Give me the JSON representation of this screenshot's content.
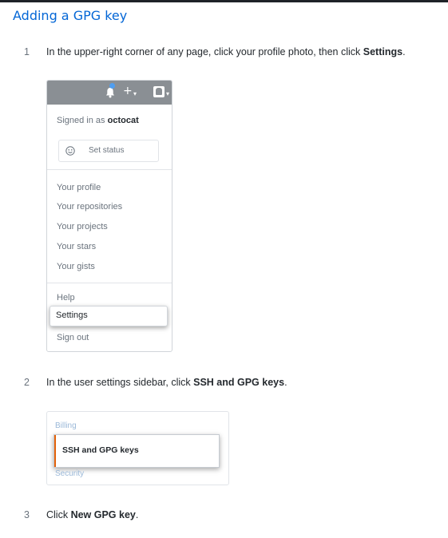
{
  "title": "Adding a GPG key",
  "steps": [
    {
      "num": "1",
      "before": "In the upper-right corner of any page, click your profile photo, then click ",
      "bold": "Settings",
      "after": "."
    },
    {
      "num": "2",
      "before": "In the user settings sidebar, click ",
      "bold": "SSH and GPG keys",
      "after": "."
    },
    {
      "num": "3",
      "before": "Click ",
      "bold": "New GPG key",
      "after": "."
    }
  ],
  "dropdown": {
    "plus": "+",
    "caret": "▾",
    "signed_prefix": "Signed in as ",
    "username": "octocat",
    "status_label": "Set status",
    "menu_items": [
      "Your profile",
      "Your repositories",
      "Your projects",
      "Your stars",
      "Your gists"
    ],
    "help": "Help",
    "settings": "Settings",
    "sign_out": "Sign out"
  },
  "sidebar": {
    "billing": "Billing",
    "ssh_gpg": "SSH and GPG keys",
    "security": "Security"
  },
  "colors": {
    "title": "#0366d6",
    "header_bar": "#8a8f94",
    "notification_dot": "#4f9ef0",
    "active_indicator": "#e36209"
  }
}
